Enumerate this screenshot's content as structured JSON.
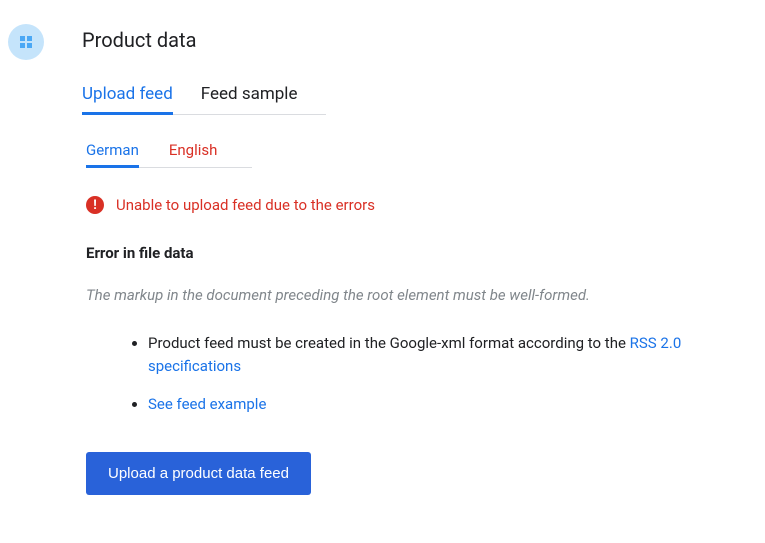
{
  "title": "Product data",
  "tabs": [
    "Upload feed",
    "Feed sample"
  ],
  "langs": [
    "German",
    "English"
  ],
  "alert": "Unable to upload feed due to the errors",
  "error_heading": "Error in file data",
  "error_desc": "The markup in the document preceding the root element must be well-formed.",
  "hint1_prefix": "Product feed must be created in the Google-xml format according to the ",
  "hint1_link": "RSS 2.0 specifications",
  "hint2_link": "See feed example",
  "button": "Upload a product data feed"
}
